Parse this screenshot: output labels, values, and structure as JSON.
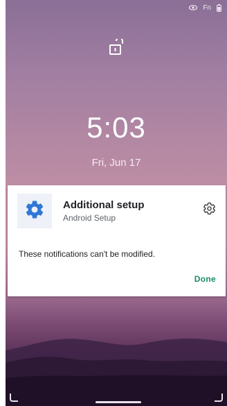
{
  "status_bar": {
    "icons": [
      "eye-icon",
      "fn-icon",
      "battery-icon"
    ],
    "fn_label": "Fn"
  },
  "lock_icon": "unlocked-padlock-icon",
  "clock": {
    "time": "5:03",
    "date": "Fri, Jun 17"
  },
  "notification": {
    "app_icon": "gear-icon",
    "title": "Additional setup",
    "subtitle": "Android Setup",
    "settings_icon": "gear-outline-icon",
    "message": "These notifications can't be modified.",
    "done_label": "Done"
  },
  "colors": {
    "app_icon_blue": "#2f78d6",
    "done_green": "#188c6a"
  }
}
